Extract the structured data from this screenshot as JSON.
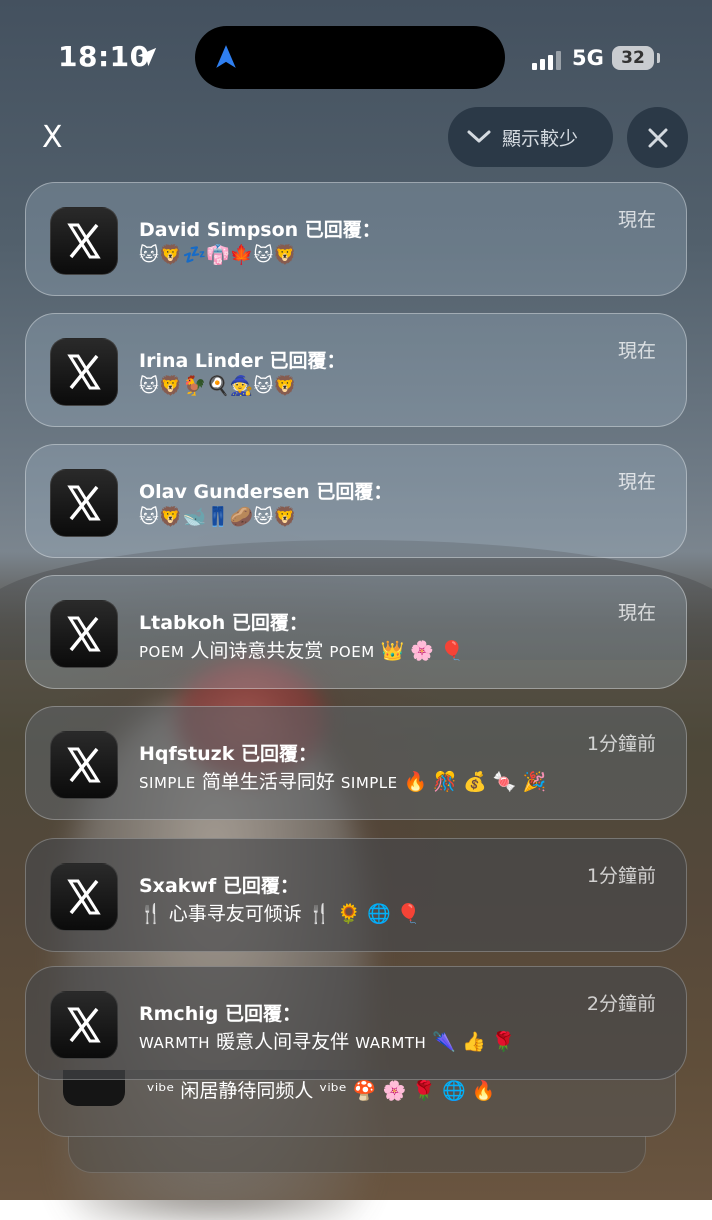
{
  "status_bar": {
    "time": "18:10",
    "network": "5G",
    "battery": "32"
  },
  "header": {
    "app_name": "X",
    "show_less_label": "顯示較少"
  },
  "notifications": [
    {
      "sender": "David Simpson 已回覆：",
      "message": "🐱🦁💤👘🍁🐱🦁",
      "time": "現在"
    },
    {
      "sender": "Irina Linder 已回覆：",
      "message": "🐱🦁🐓🍳🧙🐱🦁",
      "time": "現在"
    },
    {
      "sender": "Olav Gundersen 已回覆：",
      "message": "🐱🦁🐋👖🥔🐱🦁",
      "time": "現在"
    },
    {
      "sender": "Ltabkoh 已回覆：",
      "message_prefix": "POEM",
      "message_main": " 人间诗意共友赏 ",
      "message_suffix": "POEM",
      "message_tail": " 👑 🌸 🎈",
      "time": "現在"
    },
    {
      "sender": "Hqfstuzk 已回覆：",
      "message_prefix": "SIMPLE",
      "message_main": " 简单生活寻同好 ",
      "message_suffix": "SIMPLE",
      "message_tail": " 🔥 🎊 💰 🍬 🎉",
      "time": "1分鐘前"
    },
    {
      "sender": "Sxakwf 已回覆：",
      "message": "🍴 心事寻友可倾诉 🍴 🌻 🌐 🎈",
      "time": "1分鐘前"
    },
    {
      "sender": "Rmchig 已回覆：",
      "message_prefix": "WARMTH",
      "message_main": " 暖意人间寻友伴 ",
      "message_suffix": "WARMTH",
      "message_tail": " 🌂 👍 🌹",
      "time": "2分鐘前"
    }
  ],
  "stacked_preview": {
    "message": "ᵛⁱᵇᵉ 闲居静待同频人 ᵛⁱᵇᵉ 🍄 🌸 🌹 🌐 🔥"
  },
  "icons": {
    "location": "location-arrow-icon",
    "navigation": "navigation-arrow-icon",
    "chevron": "chevron-down-icon",
    "close": "close-icon",
    "app": "x-logo-icon"
  },
  "colors": {
    "nav_arrow": "#2f7ff0",
    "pill_bg": "#263442"
  }
}
